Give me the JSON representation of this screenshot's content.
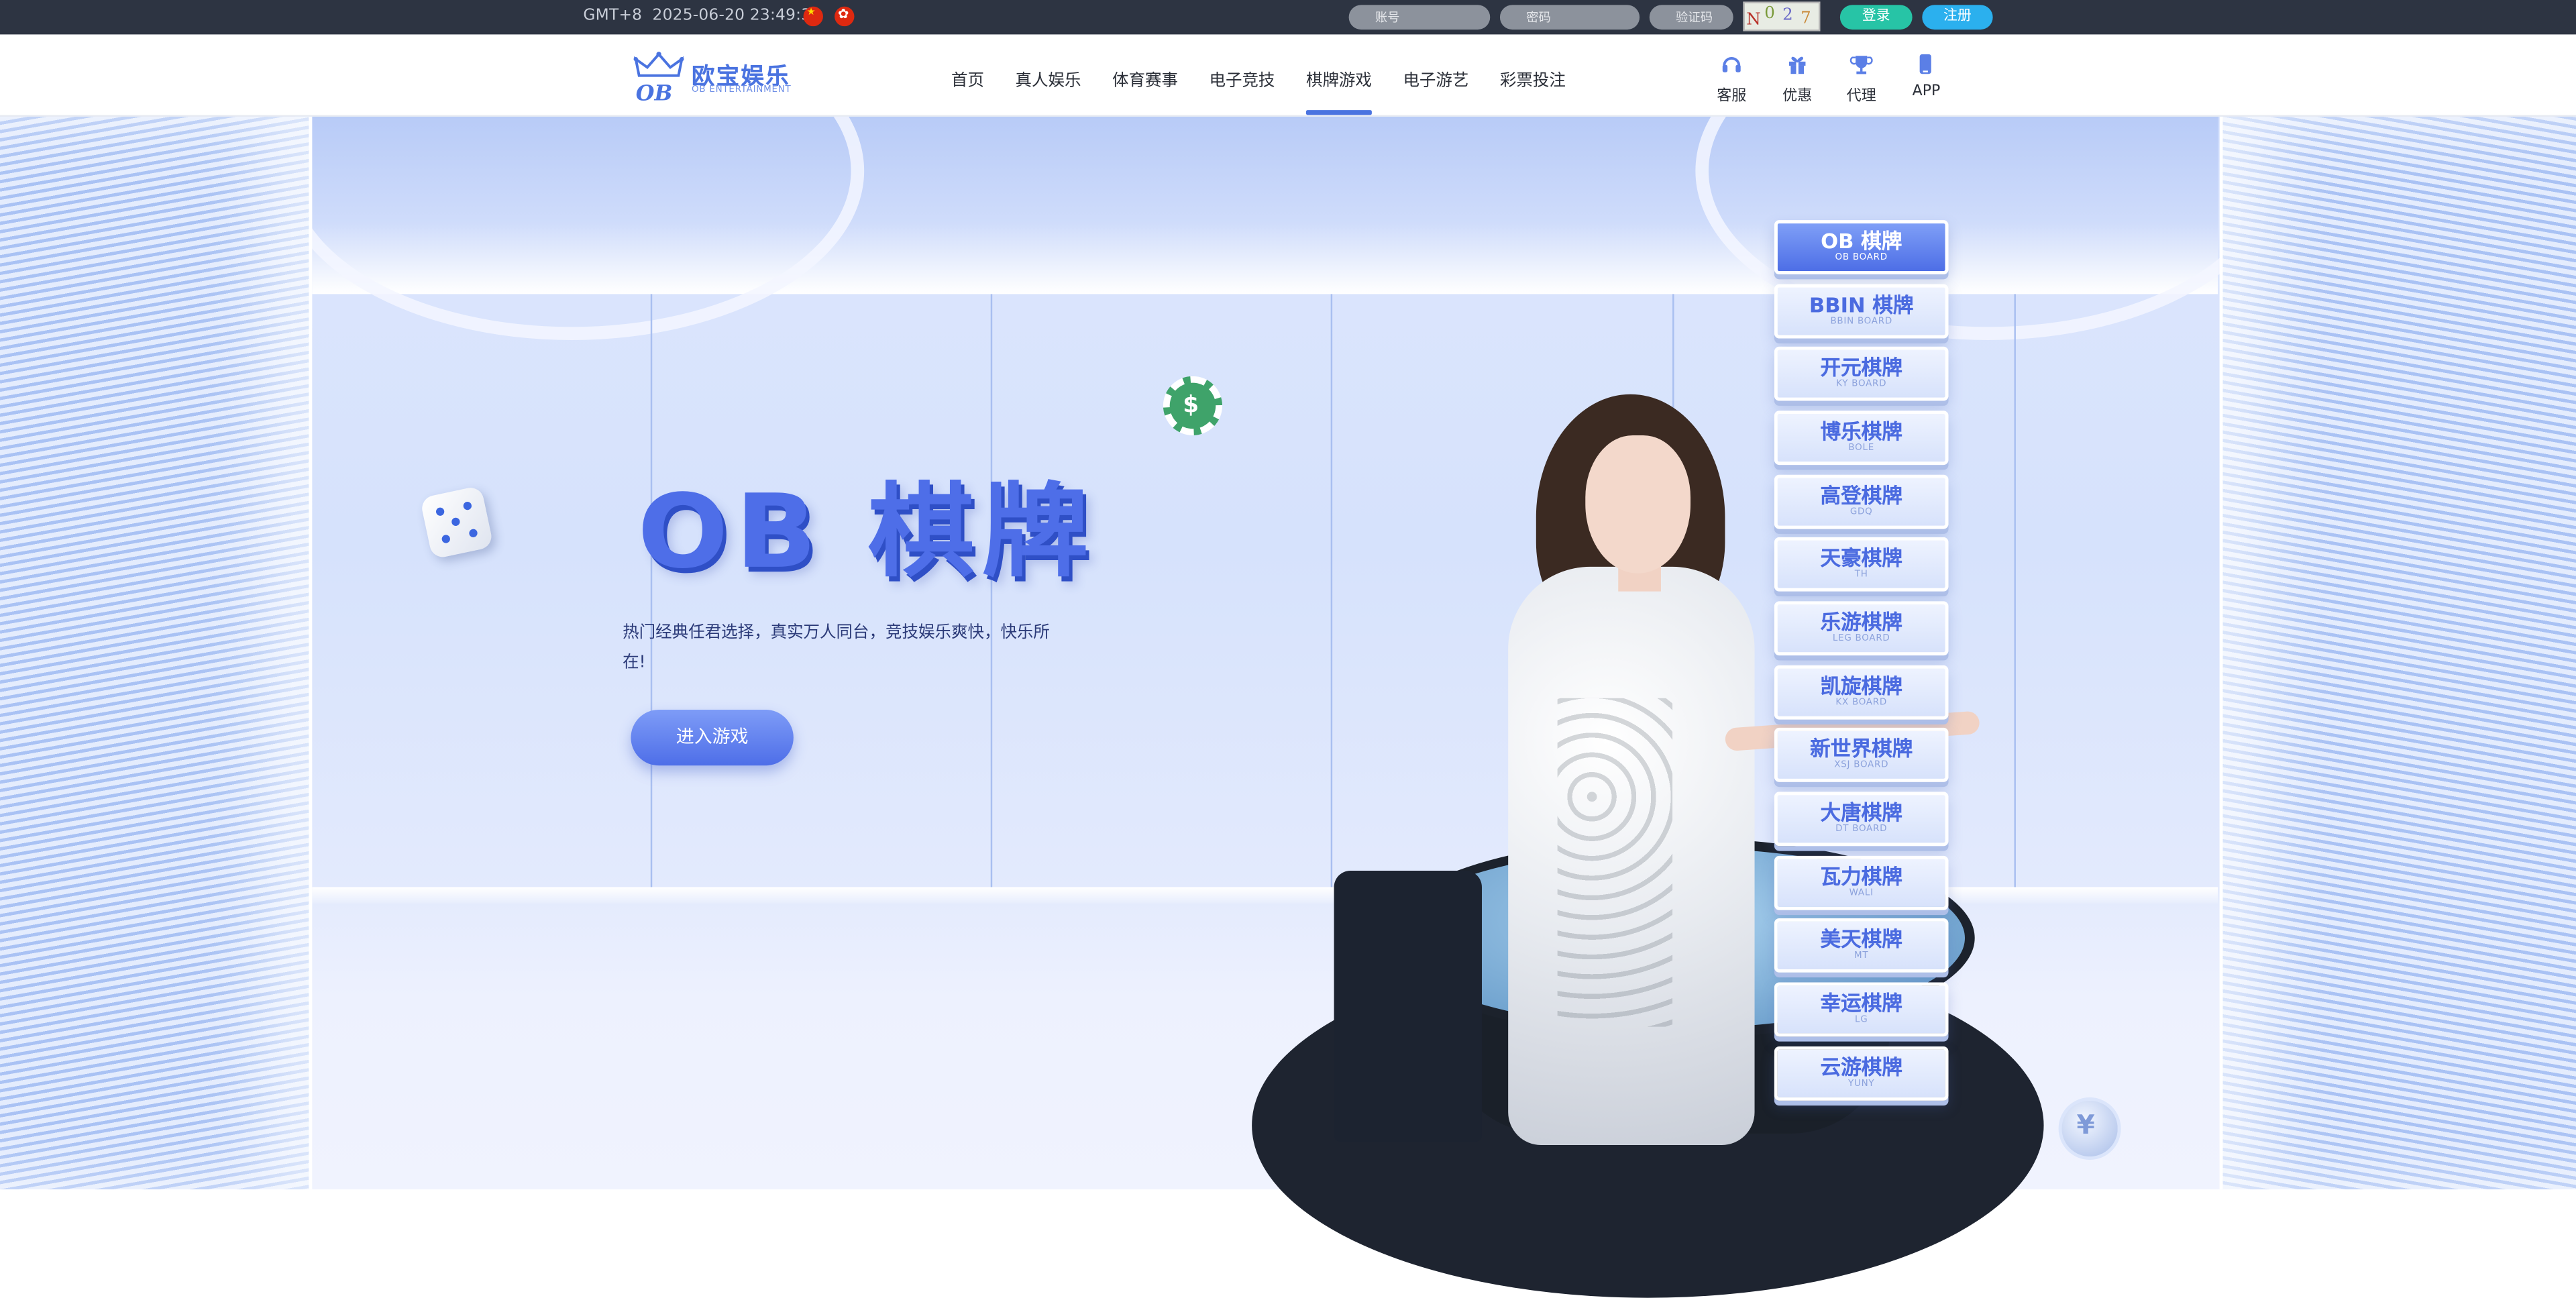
{
  "topbar": {
    "timezone": "GMT+8",
    "datetime": "2025-06-20 23:49:31",
    "username_placeholder": "账号",
    "password_placeholder": "密码",
    "captcha_placeholder": "验证码",
    "captcha_text": [
      "N",
      "0",
      "2",
      "7"
    ],
    "login_label": "登录",
    "register_label": "注册"
  },
  "header": {
    "logo_cn": "欧宝娱乐",
    "logo_en": "OB ENTERTAINMENT",
    "nav": [
      "首页",
      "真人娱乐",
      "体育赛事",
      "电子竞技",
      "棋牌游戏",
      "电子游艺",
      "彩票投注"
    ],
    "active_nav": "棋牌游戏",
    "tools": [
      {
        "label": "客服",
        "icon": "headset-icon"
      },
      {
        "label": "优惠",
        "icon": "gift-icon"
      },
      {
        "label": "代理",
        "icon": "trophy-icon"
      },
      {
        "label": "APP",
        "icon": "phone-icon"
      }
    ]
  },
  "banner": {
    "title": "OB 棋牌",
    "subtitle": "热门经典任君选择，真实万人同台，竞技娱乐爽快，快乐所在!",
    "enter_label": "进入游戏",
    "accent_color": "#4e6ee8",
    "categories": [
      {
        "name": "OB 棋牌",
        "en": "OB BOARD"
      },
      {
        "name": "BBIN 棋牌",
        "en": "BBIN BOARD"
      },
      {
        "name": "开元棋牌",
        "en": "KY BOARD"
      },
      {
        "name": "博乐棋牌",
        "en": "BOLE"
      },
      {
        "name": "高登棋牌",
        "en": "GDQ"
      },
      {
        "name": "天豪棋牌",
        "en": "TH"
      },
      {
        "name": "乐游棋牌",
        "en": "LEG BOARD"
      },
      {
        "name": "凯旋棋牌",
        "en": "KX BOARD"
      },
      {
        "name": "新世界棋牌",
        "en": "XSJ BOARD"
      },
      {
        "name": "大唐棋牌",
        "en": "DT BOARD"
      },
      {
        "name": "瓦力棋牌",
        "en": "WALI"
      },
      {
        "name": "美天棋牌",
        "en": "MT"
      },
      {
        "name": "幸运棋牌",
        "en": "LG"
      },
      {
        "name": "云游棋牌",
        "en": "YUNY"
      }
    ],
    "active_category": "OB 棋牌"
  }
}
